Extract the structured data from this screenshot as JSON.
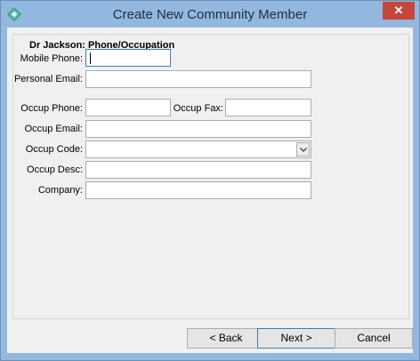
{
  "window": {
    "title": "Create New Community Member",
    "close_glyph": "✕",
    "icon": "app-diamond-icon",
    "colors": {
      "titlebar": "#93b8e0",
      "close": "#c7463c",
      "client": "#f0f0f0"
    }
  },
  "form": {
    "group_title": "Dr Jackson: Phone/Occupation",
    "mobile_phone": {
      "label": "Mobile Phone:",
      "value": ""
    },
    "personal_email": {
      "label": "Personal Email:",
      "value": ""
    },
    "occup_phone": {
      "label": "Occup Phone:",
      "value": ""
    },
    "occup_fax": {
      "label": "Occup Fax:",
      "value": ""
    },
    "occup_email": {
      "label": "Occup Email:",
      "value": ""
    },
    "occup_code": {
      "label": "Occup Code:",
      "value": ""
    },
    "occup_desc": {
      "label": "Occup Desc:",
      "value": ""
    },
    "company": {
      "label": "Company:",
      "value": ""
    }
  },
  "buttons": {
    "back": "< Back",
    "next": "Next >",
    "cancel": "Cancel"
  }
}
